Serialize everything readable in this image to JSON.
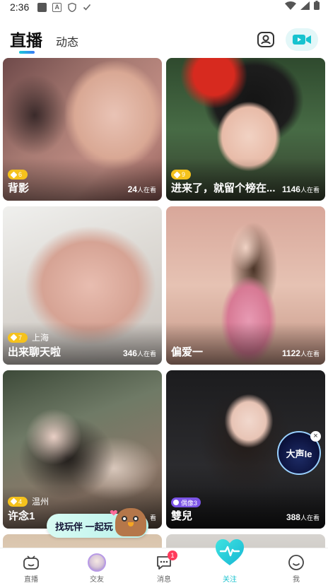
{
  "status_bar": {
    "time": "2:36",
    "icons": [
      "notification-icon",
      "a-icon",
      "shield-icon",
      "check-icon"
    ],
    "right_icons": [
      "wifi-icon",
      "signal-icon",
      "battery-icon"
    ]
  },
  "header": {
    "tabs": [
      {
        "label": "直播",
        "active": true
      },
      {
        "label": "动态",
        "active": false
      }
    ],
    "profile_icon": "profile-card-icon",
    "video_icon": "video-camera-icon",
    "accent": "#18c9d8"
  },
  "cards": [
    {
      "title": "背影",
      "level": "6",
      "location": "",
      "count": "24",
      "count_suffix": "人在看"
    },
    {
      "title": "进来了，就留个榜在...",
      "level": "9",
      "location": "",
      "count": "1146",
      "count_suffix": "人在看"
    },
    {
      "title": "出来聊天啦",
      "level": "7",
      "location": "上海",
      "count": "346",
      "count_suffix": "人在看"
    },
    {
      "title": "偏爱一",
      "level": "",
      "location": "",
      "count": "1122",
      "count_suffix": "人在看"
    },
    {
      "title": "许念1",
      "level": "4",
      "location": "温州",
      "count": "",
      "count_suffix": "看"
    },
    {
      "title": "雙兒",
      "level": "",
      "idol_badge": "偶像3",
      "location": "",
      "count": "388",
      "count_suffix": "人在看"
    }
  ],
  "album": {
    "text": "大声Ie",
    "close": "×"
  },
  "promo": {
    "label": "找玩伴 一起玩"
  },
  "bottom_nav": [
    {
      "label": "直播",
      "icon": "tv-icon",
      "active": false
    },
    {
      "label": "交友",
      "icon": "avatar",
      "active": false
    },
    {
      "label": "消息",
      "icon": "chat-icon",
      "active": false,
      "badge": "1"
    },
    {
      "label": "关注",
      "icon": "heart-pulse-icon",
      "active": true
    },
    {
      "label": "我",
      "icon": "smile-icon",
      "active": false
    }
  ]
}
